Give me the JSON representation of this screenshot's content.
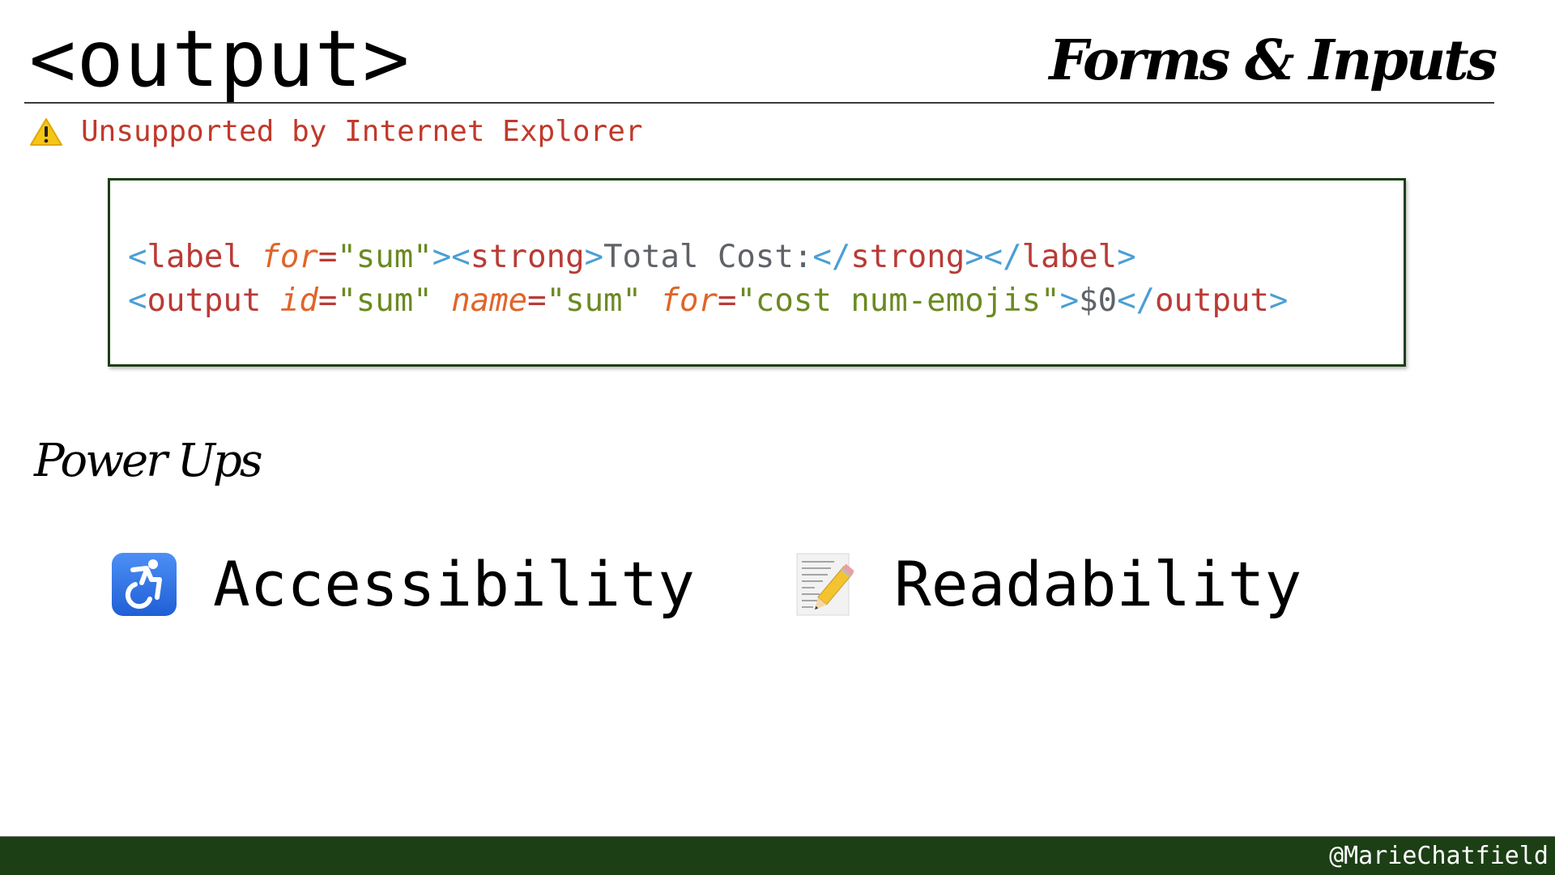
{
  "header": {
    "title": "<output>",
    "section": "Forms & Inputs"
  },
  "warning": {
    "icon": "warning-icon",
    "text": "Unsupported by Internet Explorer"
  },
  "code": {
    "line1": [
      {
        "type": "punct",
        "text": "<"
      },
      {
        "type": "tag",
        "text": "label"
      },
      {
        "type": "space",
        "text": " "
      },
      {
        "type": "attr",
        "text": "for"
      },
      {
        "type": "eq",
        "text": "="
      },
      {
        "type": "str",
        "text": "\"sum\""
      },
      {
        "type": "punct",
        "text": "><"
      },
      {
        "type": "tag",
        "text": "strong"
      },
      {
        "type": "punct",
        "text": ">"
      },
      {
        "type": "text",
        "text": "Total Cost:"
      },
      {
        "type": "punct",
        "text": "</"
      },
      {
        "type": "tag",
        "text": "strong"
      },
      {
        "type": "punct",
        "text": "></"
      },
      {
        "type": "tag",
        "text": "label"
      },
      {
        "type": "punct",
        "text": ">"
      }
    ],
    "line2": [
      {
        "type": "punct",
        "text": "<"
      },
      {
        "type": "tag",
        "text": "output"
      },
      {
        "type": "space",
        "text": " "
      },
      {
        "type": "attr",
        "text": "id"
      },
      {
        "type": "eq",
        "text": "="
      },
      {
        "type": "str",
        "text": "\"sum\""
      },
      {
        "type": "space",
        "text": " "
      },
      {
        "type": "attr",
        "text": "name"
      },
      {
        "type": "eq",
        "text": "="
      },
      {
        "type": "str",
        "text": "\"sum\""
      },
      {
        "type": "space",
        "text": " "
      },
      {
        "type": "attr",
        "text": "for"
      },
      {
        "type": "eq",
        "text": "="
      },
      {
        "type": "str",
        "text": "\"cost num-emojis\""
      },
      {
        "type": "punct",
        "text": ">"
      },
      {
        "type": "text",
        "text": "$0"
      },
      {
        "type": "punct",
        "text": "</"
      },
      {
        "type": "tag",
        "text": "output"
      },
      {
        "type": "punct",
        "text": ">"
      }
    ]
  },
  "powerups": {
    "heading": "Power Ups",
    "items": [
      {
        "icon": "wheelchair-icon",
        "label": "Accessibility"
      },
      {
        "icon": "memo-icon",
        "label": "Readability"
      }
    ]
  },
  "footer": {
    "handle": "@MarieChatfield"
  },
  "colors": {
    "brand_green": "#1c3f15",
    "warning_red": "#c0392b",
    "code_punct": "#4a9fd5",
    "code_tag": "#b93b36",
    "code_attr": "#e0652a",
    "code_string": "#6b8a22",
    "code_text": "#5f6368"
  }
}
